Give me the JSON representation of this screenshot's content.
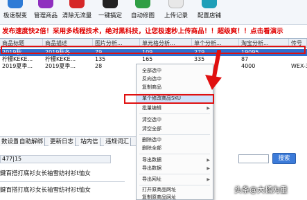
{
  "toolbar": {
    "buttons": [
      {
        "label": "极速裂变",
        "color": "#2e7bd6"
      },
      {
        "label": "管理商品",
        "color": "#8f2fbf"
      },
      {
        "label": "清除无流量",
        "color": "#d62828"
      },
      {
        "label": "一键搞定",
        "color": "#222222"
      },
      {
        "label": "自动修图",
        "color": "#2f9e44"
      },
      {
        "label": "上传记录",
        "color": "#e8e8e8"
      },
      {
        "label": "配置店铺",
        "color": "#1f9fb8"
      }
    ]
  },
  "banner": {
    "text": "发布速度快2倍！采用多线程技术，绝对黑科技，让您极速秒上传商品！！超级爽！！点击看演示"
  },
  "table": {
    "headers": [
      "商品标题",
      "商品描述",
      "图片分析...",
      "单元格分析...",
      "单个分析...",
      "淘宝分析...",
      "传号"
    ],
    "rows": [
      {
        "cells": [
          "2019秋...",
          "2019秋冬...",
          "79",
          "109",
          "279",
          "19095",
          ""
        ],
        "selected": true
      },
      {
        "cells": [
          "柠檬KEKE...",
          "柠檬KEKE...",
          "135",
          "165",
          "335",
          "87",
          ""
        ],
        "selected": false
      },
      {
        "cells": [
          "2019夏季...",
          "2019夏季...",
          "28",
          "58",
          "",
          "4000",
          "WEX-3"
        ],
        "selected": false
      }
    ]
  },
  "context_menu": {
    "items": [
      {
        "label": "全部选中",
        "submenu": false
      },
      {
        "label": "反向选中",
        "submenu": false
      },
      {
        "label": "复制商品",
        "submenu": false
      },
      {
        "label": "单个修改商品SKU",
        "submenu": false,
        "highlight": true
      },
      {
        "label": "批量编辑",
        "submenu": true
      },
      {
        "label": "清空选中",
        "submenu": false
      },
      {
        "label": "清空全部",
        "submenu": false
      },
      {
        "label": "删除选中",
        "submenu": false
      },
      {
        "label": "删除全部",
        "submenu": false
      },
      {
        "label": "导出数据",
        "submenu": true
      },
      {
        "label": "导出数据",
        "submenu": true
      },
      {
        "label": "导出网址",
        "submenu": true
      },
      {
        "label": "打开原商品网址",
        "submenu": false
      },
      {
        "label": "复制原商品网址",
        "submenu": false
      }
    ]
  },
  "bottom_tabs": [
    "数设置",
    "自助解绑",
    "更新日志",
    "站内信",
    "违规词汇"
  ],
  "panel": {
    "field_value": "477|15",
    "desc_1": "鍵百搭打底衫女长袖雪纺衬衫t恤女",
    "desc_2": "鍵百搭打底衫女长袖雪纺衬衫t恤女"
  },
  "search": {
    "button_label": "搜索",
    "placeholder": ""
  },
  "watermark": "头条@大橘为重"
}
